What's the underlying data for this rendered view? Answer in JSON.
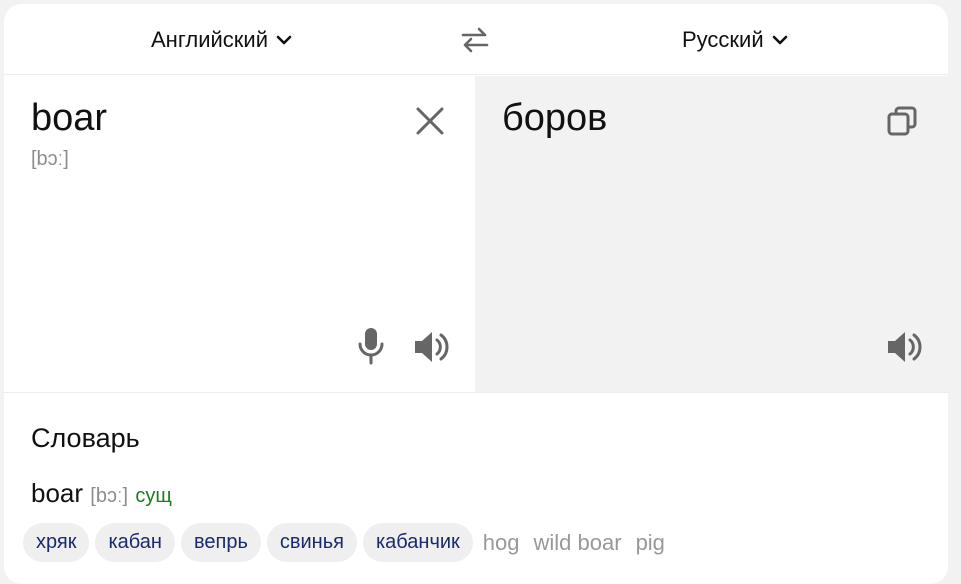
{
  "languages": {
    "source": "Английский",
    "target": "Русский",
    "swap_icon": "swap-arrows-icon"
  },
  "source": {
    "text": "boar",
    "transcription": "[bɔː]"
  },
  "target": {
    "text": "боров"
  },
  "dictionary": {
    "title": "Словарь",
    "entry": {
      "word": "boar",
      "transcription": "[bɔː]",
      "pos": "сущ"
    },
    "translations": [
      "хряк",
      "кабан",
      "вепрь",
      "свинья",
      "кабанчик"
    ],
    "synonyms": [
      "hog",
      "wild boar",
      "pig"
    ]
  }
}
